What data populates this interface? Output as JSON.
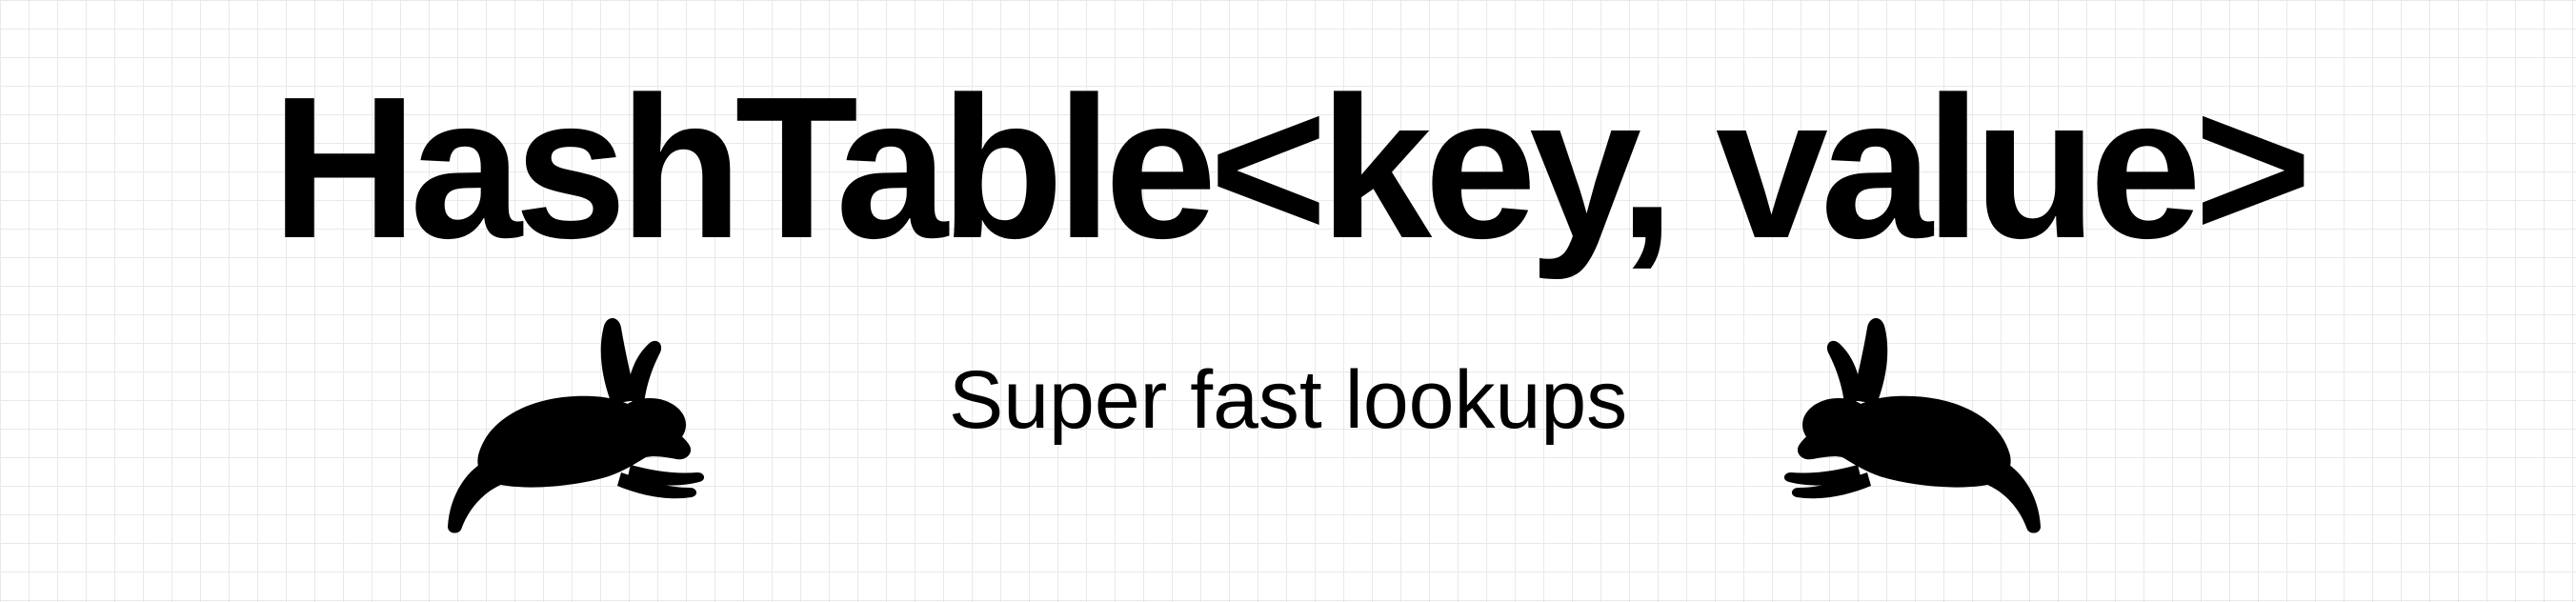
{
  "title": "HashTable<key, value>",
  "subtitle": "Super fast lookups",
  "icons": {
    "left": "running-rabbit-icon",
    "right": "running-rabbit-icon"
  },
  "colors": {
    "background": "#ffffff",
    "grid": "#e9e9e9",
    "ink": "#000000"
  }
}
